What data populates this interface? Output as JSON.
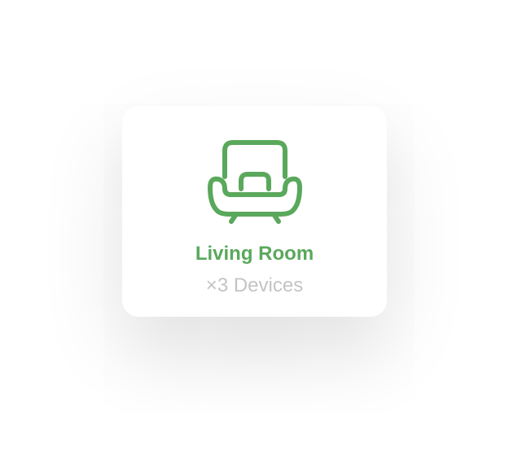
{
  "card": {
    "icon": "armchair-icon",
    "title": "Living Room",
    "subtitle": "×3 Devices"
  },
  "colors": {
    "accent": "#5aa85c",
    "muted": "#c4c4c4",
    "card_bg": "#ffffff",
    "page_bg": "#ffffff"
  }
}
